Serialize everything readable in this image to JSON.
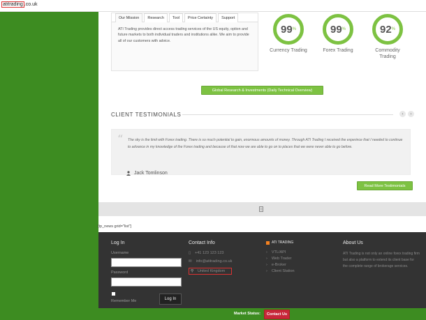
{
  "urlbar": {
    "domain_highlight": "atitrading",
    "domain_rest": ".co.uk"
  },
  "tabs": [
    {
      "label": "Our Mission"
    },
    {
      "label": "Research"
    },
    {
      "label": "Tool"
    },
    {
      "label": "Price Certainty"
    },
    {
      "label": "Support"
    }
  ],
  "mission_text": "ATI Trading provides direct access trading services of the US equity, option and future markets to both individual traders and institutions alike. We aim to provide all of our customers with advice.",
  "stats": [
    {
      "value": "99",
      "unit": "%",
      "label": "Currency Trading"
    },
    {
      "value": "99",
      "unit": "%",
      "label": "Forex Trading"
    },
    {
      "value": "92",
      "unit": "%",
      "label": "Commodity Trading"
    }
  ],
  "cta_button": "Global Research & Investments (Daily Technical Overview)",
  "testimonials": {
    "title": "CLIENT TESTIMONIALS",
    "prev_icon": "‹",
    "next_icon": "›",
    "quote": "The sky is the limit with Forex trading. There is so much potential to gain, enormous amounts of money. Through ATI Trading I received the experince that I needed to continue to advance in my knowledge of the Forex trading and because of that now we are able to go on to places that we were never able to go before.",
    "author": "Jack Tomlinson",
    "read_more": "Read More Testimonials"
  },
  "tp_news": "[tp_news grid=\"list\"]",
  "footer": {
    "login": {
      "title": "Log In",
      "username_label": "Username",
      "password_label": "Password",
      "remember_label": "Remember Me",
      "button": "Log In"
    },
    "contact": {
      "title": "Contact Info",
      "phone": "+41 123 123 123",
      "email": "info@atitrading.co.uk",
      "location": "United Kingdom"
    },
    "links": {
      "title": "ATI TRADING",
      "items": [
        "VTL/API",
        "Web Trader",
        "e-Broker",
        "Client Station"
      ]
    },
    "about": {
      "title": "About Us",
      "text": "ATI Trading is not only an online forex trading firm but also a platform to extend its client base for the complete range of brokerage services."
    }
  },
  "statusbar": {
    "label": "Market Status:",
    "contact_button": "Contact Us"
  },
  "colors": {
    "accent_green": "#7dc242",
    "page_green": "#3d8c21",
    "footer_dark": "#333333",
    "contact_red": "#c8273a"
  }
}
